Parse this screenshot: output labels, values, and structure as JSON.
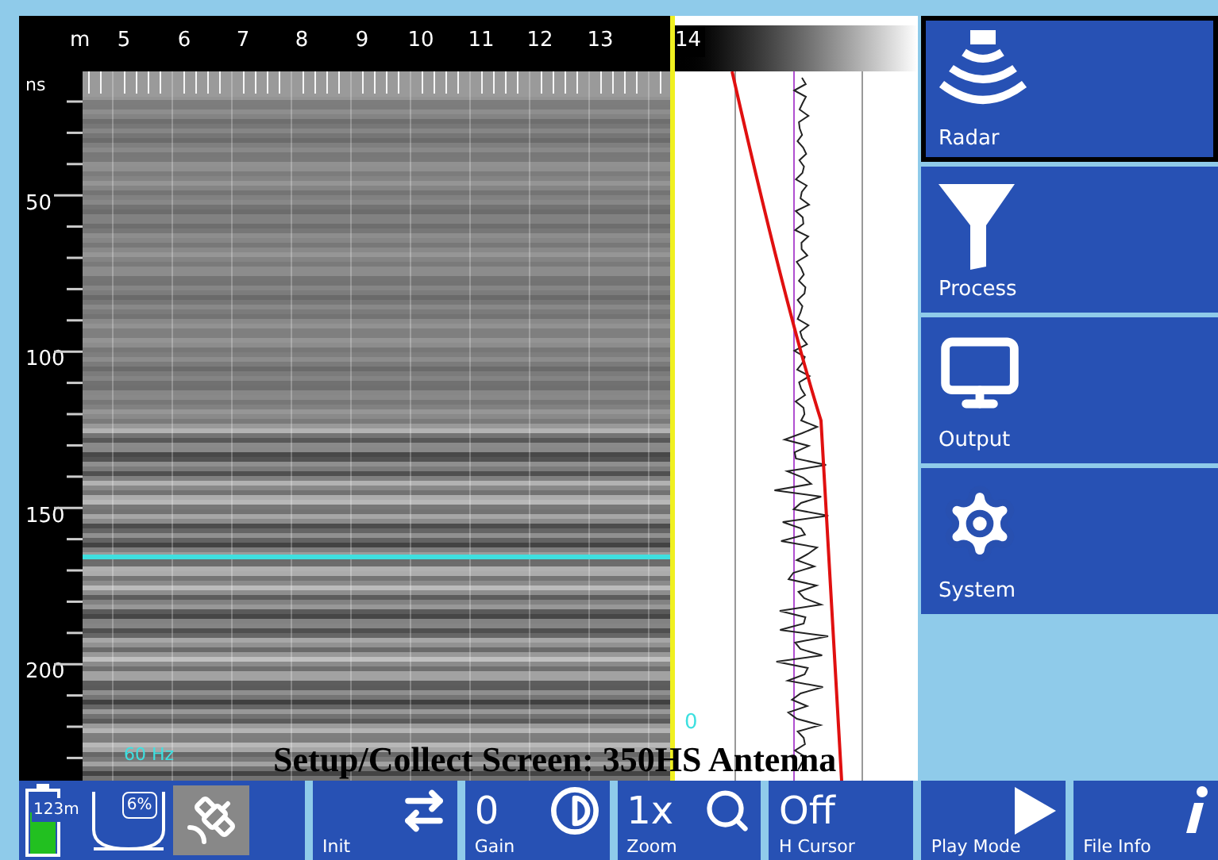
{
  "ruler": {
    "unit": "m",
    "labels": [
      "5",
      "6",
      "7",
      "8",
      "9",
      "10",
      "11",
      "12",
      "13",
      "14"
    ]
  },
  "depth_axis": {
    "unit": "ns",
    "labels": [
      "50",
      "100",
      "150",
      "200"
    ]
  },
  "radargram": {
    "frequency": "60 Hz"
  },
  "trace": {
    "label": "0"
  },
  "menu": [
    {
      "label": "Radar",
      "selected": true
    },
    {
      "label": "Process",
      "selected": false
    },
    {
      "label": "Output",
      "selected": false
    },
    {
      "label": "System",
      "selected": false
    }
  ],
  "status": {
    "distance": "123m",
    "percent": "6%"
  },
  "toolbar": [
    {
      "label": "Init"
    },
    {
      "label": "Gain",
      "value": "0"
    },
    {
      "label": "Zoom",
      "value": "1x"
    },
    {
      "label": "H Cursor",
      "value": "Off"
    },
    {
      "label": "Play Mode"
    },
    {
      "label": "File Info"
    }
  ],
  "caption": "Setup/Collect Screen: 350HS Antenna"
}
